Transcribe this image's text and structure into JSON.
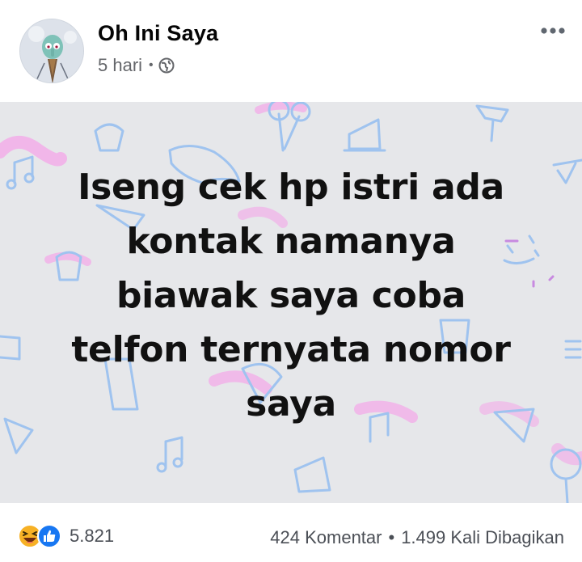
{
  "post": {
    "author_name": "Oh Ini Saya",
    "timestamp": "5 hari",
    "separator": "•",
    "privacy_icon": "globe-icon",
    "more_icon": "more-options-icon",
    "image_text": "Iseng cek hp istri ada\nkontak namanya\nbiawak saya coba\ntelfon ternyata nomor\nsaya"
  },
  "footer": {
    "reaction_icons": [
      "haha-icon",
      "like-icon"
    ],
    "reaction_count": "5.821",
    "comments": "424 Komentar",
    "separator": "•",
    "shares": "1.499 Kali Dibagikan"
  },
  "colors": {
    "accent_blue": "#1877f2",
    "haha_yellow": "#f7b125",
    "meta_gray": "#65676b",
    "image_bg": "#e6e7ea",
    "doodle_pink": "#f4a6e8",
    "doodle_blue": "#9fc3ef"
  }
}
